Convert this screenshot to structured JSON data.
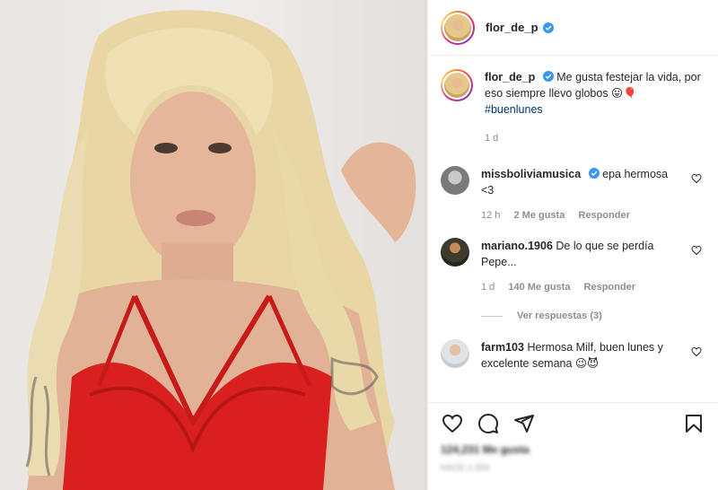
{
  "header": {
    "username": "flor_de_p"
  },
  "caption": {
    "username": "flor_de_p",
    "text": "Me gusta festejar la vida, por eso siempre llevo globos 😛🎈",
    "hashtag": "#buenlunes",
    "time": "1 d"
  },
  "comments": [
    {
      "username": "missboliviamusica",
      "verified": true,
      "text": "epa hermosa <3",
      "time": "12 h",
      "likes": "2 Me gusta",
      "reply": "Responder"
    },
    {
      "username": "mariano.1906",
      "verified": false,
      "text": "De lo que se perdía Pepe...",
      "time": "1 d",
      "likes": "140 Me gusta",
      "reply": "Responder"
    },
    {
      "username": "farm103",
      "verified": false,
      "text": "Hermosa Milf, buen lunes y excelente semana 😉😈"
    }
  ],
  "view_replies": "Ver respuestas (3)",
  "footer": {
    "likes": "124,231 Me gusta",
    "date": "HACE 1 DÍA"
  },
  "colors": {
    "verified": "#3897f0",
    "hashtag": "#00376b",
    "secondary_text": "#8e8e8e",
    "border": "#efefef"
  },
  "icons": [
    "heart-icon",
    "comment-icon",
    "share-icon",
    "bookmark-icon",
    "verified-badge-icon"
  ]
}
